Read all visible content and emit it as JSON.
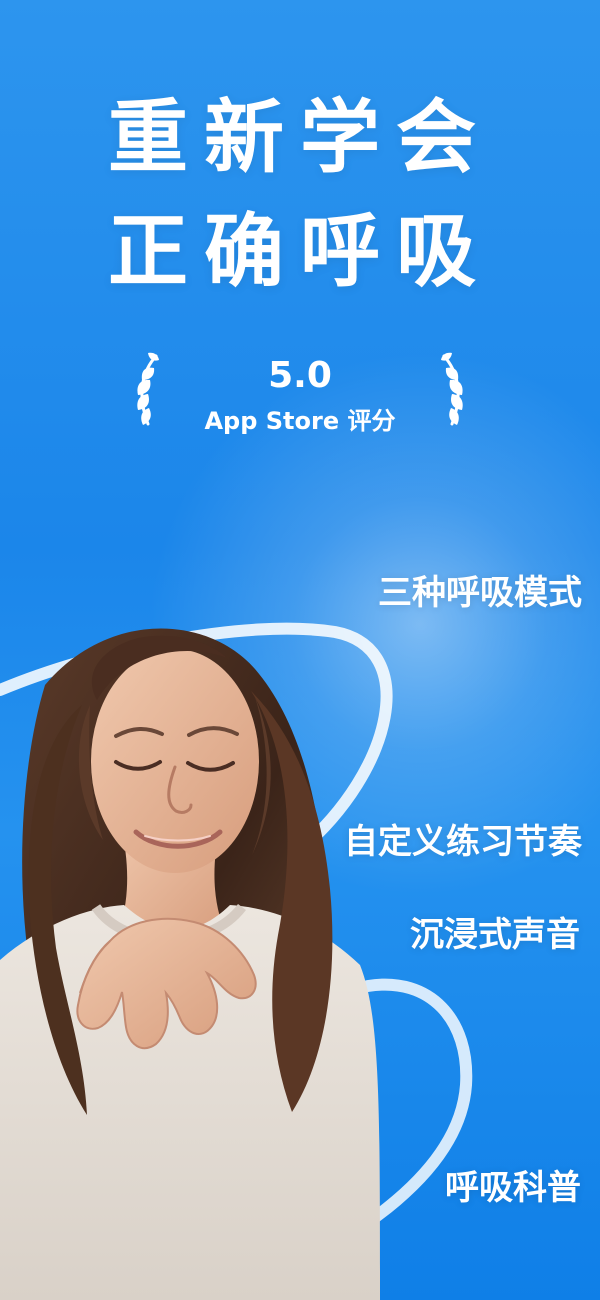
{
  "headline": {
    "line1": "重新学会",
    "line2": "正确呼吸"
  },
  "rating": {
    "score": "5.0",
    "caption": "App Store 评分"
  },
  "features": [
    "三种呼吸模式",
    "自定义练习节奏",
    "沉浸式声音",
    "呼吸科普"
  ],
  "colors": {
    "background_top": "#2d95ee",
    "background_bottom": "#0f7fe7",
    "text": "#ffffff"
  }
}
